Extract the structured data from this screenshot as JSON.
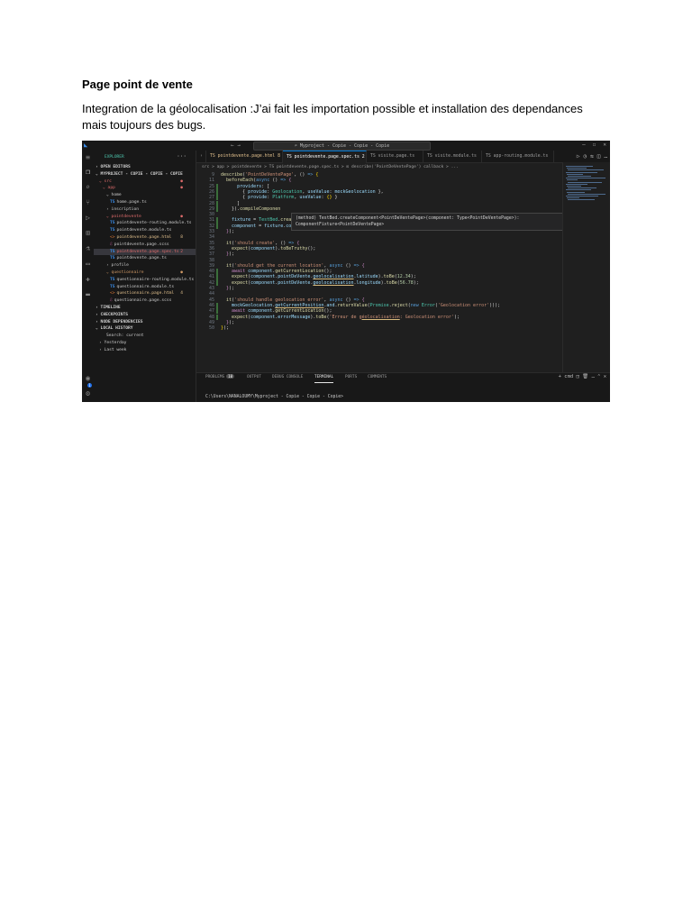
{
  "document": {
    "title": "Page point de vente",
    "paragraph_line1": "Integration de la géolocalisation :J’ai fait les importation possible et installation des dependances",
    "paragraph_line2": "mais toujours des bugs."
  },
  "screenshot": {
    "titlebar": {
      "nav": "← →",
      "command_center": "Myproject - Copie - Copie - Copie"
    },
    "sidebar": {
      "header": "EXPLORER",
      "dots": "···",
      "tree": [
        {
          "label": "OPEN EDITORS",
          "indent": 2,
          "section": true,
          "chev": "›"
        },
        {
          "label": "MYPROJECT - COPIE - COPIE - COPIE",
          "indent": 2,
          "section": true,
          "chev": "⌄"
        },
        {
          "label": "src",
          "indent": 6,
          "chev": "⌄",
          "color": "red",
          "badge": "●"
        },
        {
          "label": "app",
          "indent": 10,
          "chev": "⌄",
          "color": "red",
          "badge": "●"
        },
        {
          "label": "home",
          "indent": 14,
          "chev": "⌄"
        },
        {
          "label": "home.page.ts",
          "indent": 18,
          "kind": "ts"
        },
        {
          "label": "inscription",
          "indent": 14,
          "chev": "›"
        },
        {
          "label": "pointdevente",
          "indent": 14,
          "chev": "⌄",
          "color": "red",
          "badge": "●"
        },
        {
          "label": "pointdevente-routing.module.ts",
          "indent": 18,
          "kind": "ts"
        },
        {
          "label": "pointdevente.module.ts",
          "indent": 18,
          "kind": "ts"
        },
        {
          "label": "pointdevente.page.html",
          "indent": 18,
          "kind": "html",
          "color": "yellow",
          "badge": "8"
        },
        {
          "label": "pointdevente.page.scss",
          "indent": 18,
          "kind": "scss"
        },
        {
          "label": "pointdevente.page.spec.ts",
          "indent": 18,
          "kind": "ts",
          "color": "red",
          "badge": "2",
          "selected": true
        },
        {
          "label": "pointdevente.page.ts",
          "indent": 18,
          "kind": "ts"
        },
        {
          "label": "profile",
          "indent": 14,
          "chev": "›"
        },
        {
          "label": "questionnaire",
          "indent": 14,
          "chev": "⌄",
          "color": "orange",
          "badge": "●"
        },
        {
          "label": "questionnaire-routing.module.ts",
          "indent": 18,
          "kind": "ts"
        },
        {
          "label": "questionnaire.module.ts",
          "indent": 18,
          "kind": "ts"
        },
        {
          "label": "questionnaire.page.html",
          "indent": 18,
          "kind": "html",
          "color": "yellow",
          "badge": "4"
        },
        {
          "label": "questionnaire.page.scss",
          "indent": 18,
          "kind": "scss"
        },
        {
          "label": "TIMELINE",
          "indent": 2,
          "section": true,
          "chev": "›"
        },
        {
          "label": "CHECKPOINTS",
          "indent": 2,
          "section": true,
          "chev": "›"
        },
        {
          "label": "NODE DEPENDENCIES",
          "indent": 2,
          "section": true,
          "chev": "›"
        },
        {
          "label": "LOCAL HISTORY",
          "indent": 2,
          "section": true,
          "chev": "⌄"
        },
        {
          "label": "Search: current",
          "indent": 14
        },
        {
          "label": "Yesterday",
          "indent": 6,
          "chev": "›"
        },
        {
          "label": "Last week",
          "indent": 6,
          "chev": "›"
        }
      ]
    },
    "tabs": [
      {
        "label": "TS pointdevente.page.html 8",
        "state": "warn"
      },
      {
        "label": "TS pointdevente.page.spec.ts 2 ×",
        "state": "active"
      },
      {
        "label": "TS visite.page.ts",
        "state": ""
      },
      {
        "label": "TS visite.module.ts",
        "state": ""
      },
      {
        "label": "TS app-routing.module.ts",
        "state": ""
      }
    ],
    "breadcrumb": "src > app > pointdevente > TS pointdevente.page.spec.ts > ⊡ describe('PointDeVentePage') callback > ...",
    "hover_line1": "(method) TestBed.createComponent<PointDeVentePage>(component: Type<PointDeVentePage>):",
    "hover_line2": "ComponentFixture<PointDeVentePage>",
    "code_lines": [
      {
        "ln": "9",
        "html": "<span class='f'>describe</span>(<span class='s'>'PointDeVentePage'</span>, () <span class='k'>=&gt;</span> <span class='y'>{</span>"
      },
      {
        "ln": "11",
        "html": "  <span class='f'>beforeEach</span>(<span class='k'>async</span> () <span class='k'>=&gt;</span> <span class='p'>{</span>"
      },
      {
        "ln": "25",
        "html": "      <span class='v'>providers</span>: [",
        "bar": true
      },
      {
        "ln": "26",
        "html": "        { <span class='v'>provide</span>: <span class='t'>Geolocation</span>, <span class='v'>useValue</span>: <span class='v'>mockGeolocation</span> },",
        "bar": true
      },
      {
        "ln": "27",
        "html": "        { <span class='v'>provide</span>: <span class='t'>Platform</span>, <span class='v'>useValue</span>: <span class='y'>{}</span> }",
        "bar": true
      },
      {
        "ln": "28",
        "html": "      ]",
        "bar": true
      },
      {
        "ln": "29",
        "html": "    }).<span class='f'>compileComponen</span>",
        "bar": true
      },
      {
        "ln": "30",
        "html": ""
      },
      {
        "ln": "31",
        "html": "    <span class='v'>fixture</span> = <span class='t'>TestBed</span>.<span class='f'>createComponent</span>(<span class='t'>PointDeVentePage</span>);",
        "bar": true
      },
      {
        "ln": "32",
        "html": "    <span class='v'>component</span> = <span class='v'>fixture</span>.<span class='v'>componentInstance</span>;",
        "bar": true
      },
      {
        "ln": "33",
        "html": "  <span class='p'>}</span>);"
      },
      {
        "ln": "34",
        "html": ""
      },
      {
        "ln": "35",
        "html": "  <span class='f'>it</span>(<span class='s'>'should create'</span>, () <span class='k'>=&gt;</span> <span class='p'>{</span>"
      },
      {
        "ln": "36",
        "html": "    <span class='f'>expect</span>(<span class='v'>component</span>).<span class='f'>toBeTruthy</span>();"
      },
      {
        "ln": "37",
        "html": "  <span class='p'>}</span>);"
      },
      {
        "ln": "38",
        "html": ""
      },
      {
        "ln": "39",
        "html": "  <span class='f'>it</span>(<span class='s'>'should get the current location'</span>, <span class='k'>async</span> () <span class='k'>=&gt;</span> <span class='p'>{</span>"
      },
      {
        "ln": "40",
        "html": "    <span class='p'>await</span> <span class='v'>component</span>.<span class='f'>getCurrentLocation</span>();",
        "bar": true
      },
      {
        "ln": "41",
        "html": "    <span class='f'>expect</span>(<span class='v'>component</span>.<span class='v'>pointDeVente</span>.<span class='v u'>geolocalisation</span>.<span class='v'>latitude</span>).<span class='f'>toBe</span>(<span class='n'>12.34</span>);",
        "bar": true
      },
      {
        "ln": "42",
        "html": "    <span class='f'>expect</span>(<span class='v'>component</span>.<span class='v'>pointDeVente</span>.<span class='v u'>geolocalisation</span>.<span class='v'>longitude</span>).<span class='f'>toBe</span>(<span class='n'>56.78</span>);",
        "bar": true
      },
      {
        "ln": "43",
        "html": "  <span class='p'>}</span>);"
      },
      {
        "ln": "44",
        "html": ""
      },
      {
        "ln": "45",
        "html": "  <span class='f'>it</span>(<span class='s'>'should handle geolocation error'</span>, <span class='k'>async</span> () <span class='k'>=&gt;</span> <span class='p'>{</span>"
      },
      {
        "ln": "46",
        "html": "    <span class='v'>mockGeolocation</span>.<span class='v u'>getCurrentPosition</span>.<span class='v'>and</span>.<span class='f'>returnValue</span>(<span class='t'>Promise</span>.<span class='f'>reject</span>(<span class='k'>new</span> <span class='t'>Error</span>(<span class='s'>'Geolocation error'</span>)));",
        "bar": true
      },
      {
        "ln": "47",
        "html": "    <span class='p'>await</span> <span class='v'>component</span>.<span class='f'>getCurrentLocation</span>();",
        "bar": true
      },
      {
        "ln": "48",
        "html": "    <span class='f'>expect</span>(<span class='v'>component</span>.<span class='v'>errorMessage</span>).<span class='f'>toBe</span>(<span class='s'>'Erreur de <span class=\"u\">géolocalisation</span>: Geolocation error'</span>);",
        "bar": true
      },
      {
        "ln": "49",
        "html": "  <span class='p'>}</span>);"
      },
      {
        "ln": "50",
        "html": "<span class='y'>}</span>);"
      }
    ],
    "panel": {
      "tabs": [
        {
          "label": "PROBLEMS",
          "count": "10"
        },
        {
          "label": "OUTPUT"
        },
        {
          "label": "DEBUG CONSOLE"
        },
        {
          "label": "TERMINAL",
          "active": true
        },
        {
          "label": "PORTS"
        },
        {
          "label": "COMMENTS"
        }
      ],
      "terminal_type": "cmd",
      "prompt": "C:\\Users\\NANALOUMY\\Myproject - Copie - Copie - Copie>"
    }
  }
}
